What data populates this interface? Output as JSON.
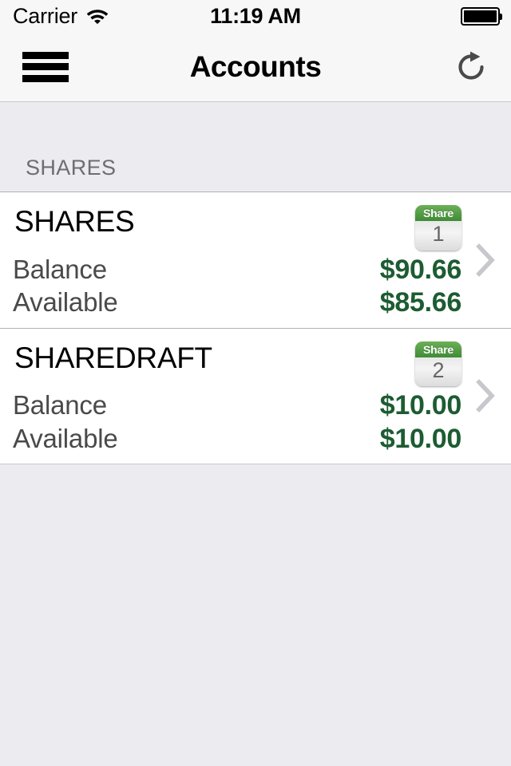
{
  "status_bar": {
    "carrier": "Carrier",
    "wifi_icon": "wifi-icon",
    "time": "11:19 AM",
    "battery_icon": "battery-full-icon"
  },
  "nav_bar": {
    "menu_icon": "hamburger-menu-icon",
    "title": "Accounts",
    "refresh_icon": "refresh-icon"
  },
  "section": {
    "header": "SHARES"
  },
  "colors": {
    "amount_green": "#1d5c32",
    "badge_green": "#58a049",
    "section_background": "#ececf0",
    "nav_background": "#f7f7f7",
    "chevron_gray": "#c7c7cc"
  },
  "accounts": [
    {
      "name": "SHARES",
      "badge_type": "Share",
      "badge_number": "1",
      "balance_label": "Balance",
      "balance_value": "$90.66",
      "available_label": "Available",
      "available_value": "$85.66",
      "chevron_icon": "chevron-right-icon"
    },
    {
      "name": "SHAREDRAFT",
      "badge_type": "Share",
      "badge_number": "2",
      "balance_label": "Balance",
      "balance_value": "$10.00",
      "available_label": "Available",
      "available_value": "$10.00",
      "chevron_icon": "chevron-right-icon"
    }
  ]
}
